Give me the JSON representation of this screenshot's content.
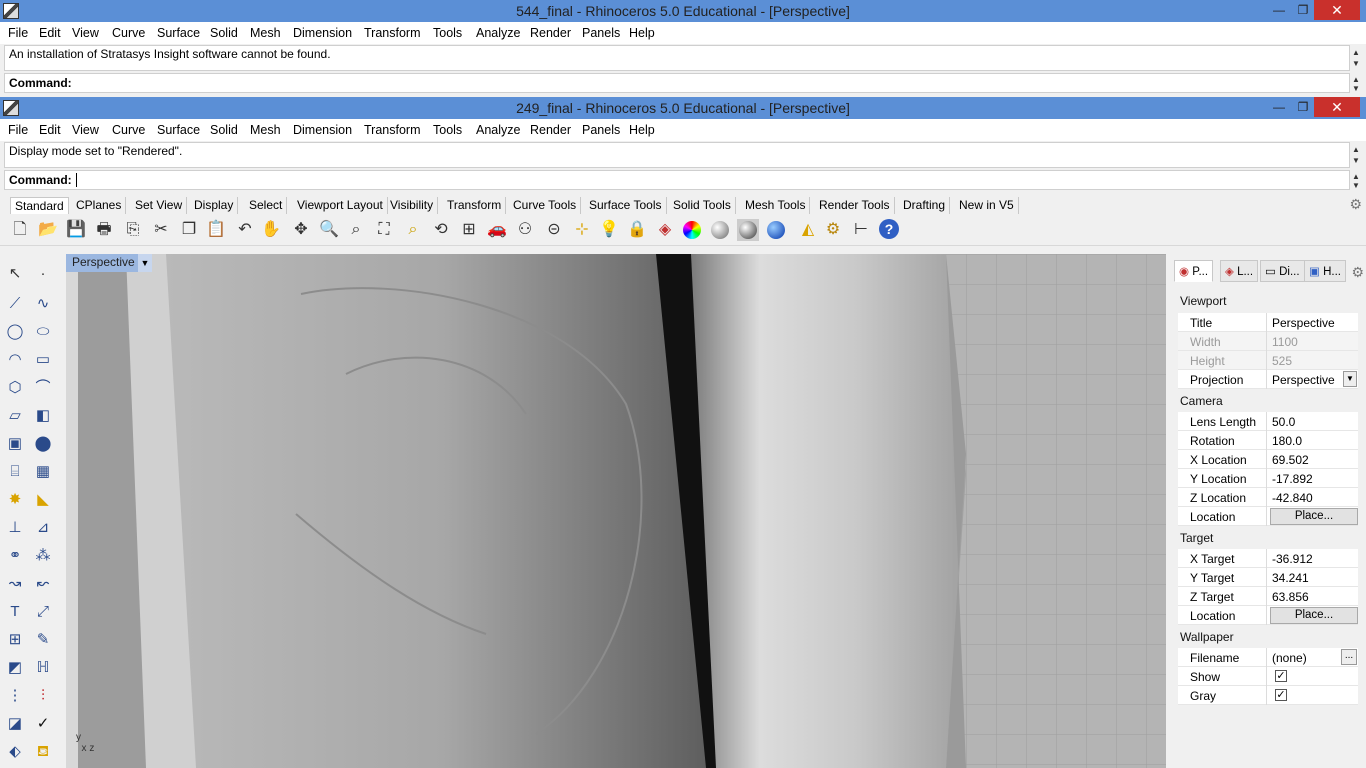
{
  "window1": {
    "title": "544_final - Rhinoceros 5.0 Educational - [Perspective]",
    "history": "An installation of Stratasys Insight software cannot be found.",
    "command_label": "Command:"
  },
  "window2": {
    "title": "249_final - Rhinoceros 5.0 Educational - [Perspective]",
    "history": "Display mode set to \"Rendered\".",
    "command_label": "Command:"
  },
  "menu": [
    "File",
    "Edit",
    "View",
    "Curve",
    "Surface",
    "Solid",
    "Mesh",
    "Dimension",
    "Transform",
    "Tools",
    "Analyze",
    "Render",
    "Panels",
    "Help"
  ],
  "toolbar_tabs": [
    "Standard",
    "CPlanes",
    "Set View",
    "Display",
    "Select",
    "Viewport Layout",
    "Visibility",
    "Transform",
    "Curve Tools",
    "Surface Tools",
    "Solid Tools",
    "Mesh Tools",
    "Render Tools",
    "Drafting",
    "New in V5"
  ],
  "viewport": {
    "label": "Perspective"
  },
  "panel": {
    "tabs": [
      "P...",
      "L...",
      "Di...",
      "H..."
    ],
    "sections": {
      "viewport": "Viewport",
      "camera": "Camera",
      "target": "Target",
      "wallpaper": "Wallpaper"
    },
    "viewport_rows": [
      {
        "k": "Title",
        "v": "Perspective"
      },
      {
        "k": "Width",
        "v": "1100"
      },
      {
        "k": "Height",
        "v": "525"
      },
      {
        "k": "Projection",
        "v": "Perspective"
      }
    ],
    "camera_rows": [
      {
        "k": "Lens Length",
        "v": "50.0"
      },
      {
        "k": "Rotation",
        "v": "180.0"
      },
      {
        "k": "X Location",
        "v": "69.502"
      },
      {
        "k": "Y Location",
        "v": "-17.892"
      },
      {
        "k": "Z Location",
        "v": "-42.840"
      },
      {
        "k": "Location",
        "v": "Place..."
      }
    ],
    "target_rows": [
      {
        "k": "X Target",
        "v": "-36.912"
      },
      {
        "k": "Y Target",
        "v": "34.241"
      },
      {
        "k": "Z Target",
        "v": "63.856"
      },
      {
        "k": "Location",
        "v": "Place..."
      }
    ],
    "wallpaper_rows": [
      {
        "k": "Filename",
        "v": "(none)"
      },
      {
        "k": "Show",
        "v": "✓"
      },
      {
        "k": "Gray",
        "v": "✓"
      }
    ]
  }
}
